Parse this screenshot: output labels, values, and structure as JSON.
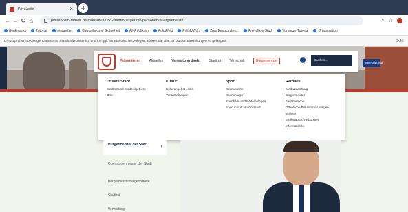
{
  "browser": {
    "tab_title": "Privatseite",
    "url": "plauencom-farben.de/tourismus-und-stadt/buergerinfo/personen/buergermeister",
    "bookmarks": [
      "Bookmarks",
      "Tutorial",
      "newsletter",
      "Bau-sehr-sind Sicherheit",
      "All-Publikum",
      "Politikfeld",
      "Politik/Wahl",
      "Zum Besuch des...",
      "Freiwillige Stadt",
      "Vorsorge-Tutorial",
      "Organisation"
    ],
    "infobar_text": "Um zu prüfen, ob Google Chrome Ihr Standardbrowser ist, und ihn ggf. als Standard festzulegen, klicken Sie hier, um zu den Einstellungen zu gelangen.",
    "infobar_close": "Schl."
  },
  "site": {
    "brand": "Präsentieren",
    "nav": [
      "Aktuelles",
      "Verwaltung direkt",
      "Stadtrat",
      "Wirtschaft",
      "Bürgerservice"
    ],
    "search_label": "Suchen...",
    "jb_label": "Jugendportal"
  },
  "menu": {
    "columns": [
      {
        "title": "Unsere Stadt",
        "items": [
          "Stadtrat und Stadtteilgebiete",
          "Orte"
        ]
      },
      {
        "title": "Kultur",
        "items": [
          "Kulturangebot Links",
          "Veranstaltungen"
        ]
      },
      {
        "title": "Sport",
        "items": [
          "Sportvereine",
          "Sportanlagen",
          "Sporthalle und Bäderanlagen",
          "Sport in und um die Stadt"
        ]
      },
      {
        "title": "Rathaus",
        "items": [
          "Stadtverwaltung",
          "Bürgermeister",
          "Fachbereiche",
          "Öffentliche Bekanntmachungen",
          "Wahlen",
          "Stellenausschreibungen",
          "Informationen"
        ]
      }
    ]
  },
  "sidebar": {
    "active": "Bürgermeister der Stadt",
    "items": [
      "Oberbürgermeister der Stadt",
      "Bürgermeisterbeigeordnete",
      "Stadtrat",
      "Verwaltung"
    ]
  }
}
